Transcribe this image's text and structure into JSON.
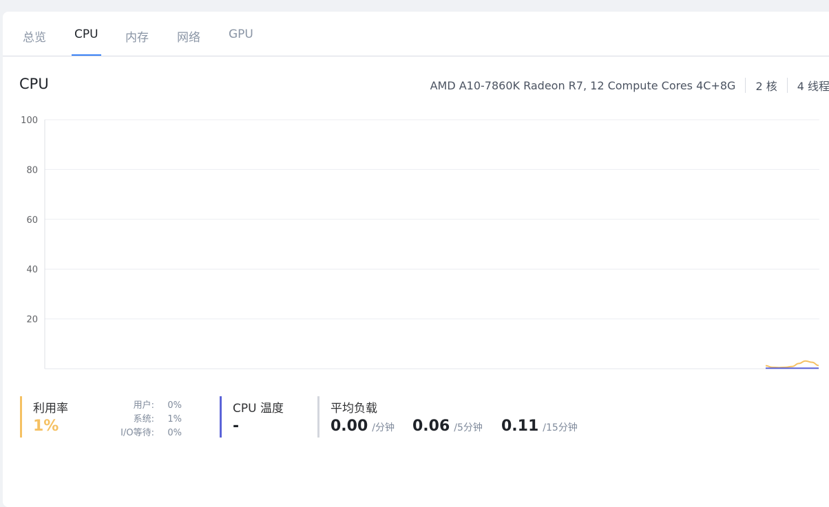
{
  "tabs": [
    {
      "label": "总览",
      "active": false
    },
    {
      "label": "CPU",
      "active": true
    },
    {
      "label": "内存",
      "active": false
    },
    {
      "label": "网络",
      "active": false
    },
    {
      "label": "GPU",
      "active": false
    }
  ],
  "header": {
    "title": "CPU",
    "model": "AMD A10-7860K Radeon R7, 12 Compute Cores 4C+8G",
    "cores": "2 核",
    "threads": "4 线程"
  },
  "chart_data": {
    "type": "line",
    "ylim": [
      0,
      100
    ],
    "yticks": [
      "100",
      "80",
      "60",
      "40",
      "20"
    ],
    "grid": true,
    "series": [
      {
        "color": "#f5c163",
        "values": [
          1.2,
          0.6,
          0.5,
          0.6,
          0.9,
          2.1,
          3.1,
          2.6,
          1.3
        ]
      },
      {
        "color": "#5b63d8",
        "values": [
          0.2,
          0.2,
          0.2,
          0.2,
          0.2,
          0.2,
          0.2,
          0.2,
          0.2
        ]
      }
    ]
  },
  "stats": {
    "utilization": {
      "label": "利用率",
      "value": "1%",
      "color": "#f5c163",
      "rows": [
        {
          "key": "用户:",
          "value": "0%"
        },
        {
          "key": "系统:",
          "value": "1%"
        },
        {
          "key": "I/O等待:",
          "value": "0%"
        }
      ]
    },
    "temperature": {
      "label": "CPU 温度",
      "value": "-",
      "color": "#5b63d8"
    },
    "load": {
      "label": "平均负载",
      "color": "#d3d6dd",
      "items": [
        {
          "value": "0.00",
          "unit": "/分钟"
        },
        {
          "value": "0.06",
          "unit": "/5分钟"
        },
        {
          "value": "0.11",
          "unit": "/15分钟"
        }
      ]
    }
  }
}
